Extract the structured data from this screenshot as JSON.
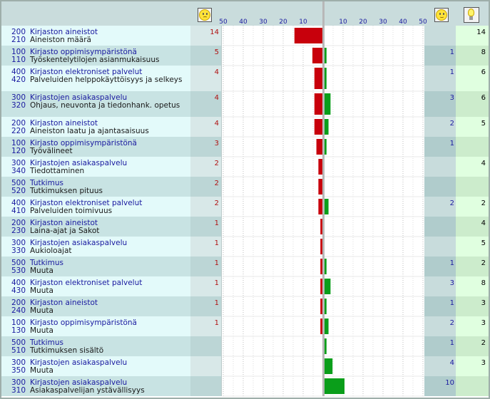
{
  "header": {
    "icons": [
      "sad-face-icon",
      "happy-face-icon",
      "lightbulb-icon"
    ],
    "left_ticks": [
      "50",
      "40",
      "30",
      "20",
      "10"
    ],
    "right_ticks": [
      "10",
      "20",
      "30",
      "40",
      "50"
    ]
  },
  "colors": {
    "negative_bar": "#c8000c",
    "positive_bar": "#0a9e1a",
    "label_text": "#1a1aa0",
    "negative_text": "#b01010"
  },
  "chart_data": {
    "type": "bar",
    "orientation": "diverging-horizontal",
    "axis_range": [
      50,
      50
    ],
    "grid": true,
    "rows": [
      {
        "code1": "200",
        "cat": "Kirjaston aineistot",
        "code2": "210",
        "sub": "Aineiston määrä",
        "negative": 14,
        "positive": 0,
        "count": 14
      },
      {
        "code1": "100",
        "cat": "Kirjasto oppimisympäristönä",
        "code2": "110",
        "sub": "Työskentelytilojen asianmukaisuus",
        "negative": 5,
        "positive": 1,
        "count": 8
      },
      {
        "code1": "400",
        "cat": "Kirjaston elektroniset palvelut",
        "code2": "420",
        "sub": "Palveluiden helppokäyttöisyys ja selkeys",
        "negative": 4,
        "positive": 1,
        "count": 6
      },
      {
        "code1": "300",
        "cat": "Kirjastojen asiakaspalvelu",
        "code2": "320",
        "sub": "Ohjaus, neuvonta ja tiedonhank. opetus",
        "negative": 4,
        "positive": 3,
        "count": 6
      },
      {
        "code1": "200",
        "cat": "Kirjaston aineistot",
        "code2": "220",
        "sub": "Aineiston laatu ja ajantasaisuus",
        "negative": 4,
        "positive": 2,
        "count": 5
      },
      {
        "code1": "100",
        "cat": "Kirjasto oppimisympäristönä",
        "code2": "120",
        "sub": "Työvälineet",
        "negative": 3,
        "positive": 1,
        "count": null
      },
      {
        "code1": "300",
        "cat": "Kirjastojen asiakaspalvelu",
        "code2": "340",
        "sub": "Tiedottaminen",
        "negative": 2,
        "positive": 0,
        "count": 4
      },
      {
        "code1": "500",
        "cat": "Tutkimus",
        "code2": "520",
        "sub": "Tutkimuksen pituus",
        "negative": 2,
        "positive": 0,
        "count": null
      },
      {
        "code1": "400",
        "cat": "Kirjaston elektroniset palvelut",
        "code2": "410",
        "sub": "Palveluiden toimivuus",
        "negative": 2,
        "positive": 2,
        "count": 2
      },
      {
        "code1": "200",
        "cat": "Kirjaston aineistot",
        "code2": "230",
        "sub": "Laina-ajat ja Sakot",
        "negative": 1,
        "positive": 0,
        "count": 4
      },
      {
        "code1": "300",
        "cat": "Kirjastojen asiakaspalvelu",
        "code2": "330",
        "sub": "Aukioloajat",
        "negative": 1,
        "positive": 0,
        "count": 5
      },
      {
        "code1": "500",
        "cat": "Tutkimus",
        "code2": "530",
        "sub": "Muuta",
        "negative": 1,
        "positive": 1,
        "count": 2
      },
      {
        "code1": "400",
        "cat": "Kirjaston elektroniset palvelut",
        "code2": "430",
        "sub": "Muuta",
        "negative": 1,
        "positive": 3,
        "count": 8
      },
      {
        "code1": "200",
        "cat": "Kirjaston aineistot",
        "code2": "240",
        "sub": "Muuta",
        "negative": 1,
        "positive": 1,
        "count": 3
      },
      {
        "code1": "100",
        "cat": "Kirjasto oppimisympäristönä",
        "code2": "130",
        "sub": "Muuta",
        "negative": 1,
        "positive": 2,
        "count": 3
      },
      {
        "code1": "500",
        "cat": "Tutkimus",
        "code2": "510",
        "sub": "Tutkimuksen sisältö",
        "negative": 0,
        "positive": 1,
        "count": 2
      },
      {
        "code1": "300",
        "cat": "Kirjastojen asiakaspalvelu",
        "code2": "350",
        "sub": "Muuta",
        "negative": 0,
        "positive": 4,
        "count": 3
      },
      {
        "code1": "300",
        "cat": "Kirjastojen asiakaspalvelu",
        "code2": "310",
        "sub": "Asiakaspalvelijan ystävällisyys",
        "negative": 0,
        "positive": 10,
        "count": null
      }
    ]
  }
}
